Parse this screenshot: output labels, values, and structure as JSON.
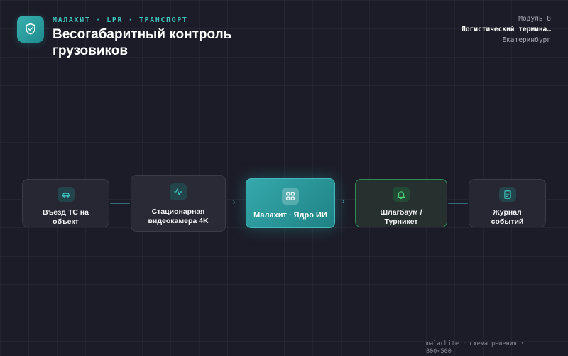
{
  "header": {
    "kicker": "МАЛАХИТ · LPR · ТРАНСПОРТ",
    "title": "Весогабаритный контроль грузовиков",
    "logo_icon": "shield-check-icon"
  },
  "meta": {
    "module": "Модуль 8",
    "site": "Логистический термина…",
    "city": "Екатеринбург"
  },
  "flow": {
    "nodes": [
      {
        "label": "Въезд ТС на объект",
        "icon": "vehicle-icon"
      },
      {
        "label": "Стационарная видеокамера 4K",
        "icon": "pulse-icon"
      },
      {
        "label": "Малахит · Ядро ИИ",
        "icon": "grid-icon"
      },
      {
        "label": "Шлагбаум / Турникет",
        "icon": "bell-icon"
      },
      {
        "label": "Журнал событий",
        "icon": "document-icon"
      }
    ]
  },
  "colors": {
    "accent": "#35a9ac",
    "background": "#1c1c28",
    "success_border": "#2e8a55",
    "kicker": "#3fc4bf"
  },
  "footer": {
    "caption": "malachite · схема решения · 800×500"
  }
}
